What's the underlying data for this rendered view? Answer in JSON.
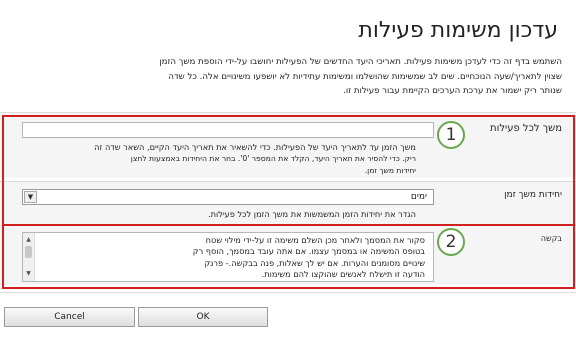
{
  "dialog": {
    "title": "עדכון משימות פעילות",
    "intro": [
      "השתמש בדף זה כדי לעדכן משימות פעילות. תאריכי היעד החדשים של הפעילות יחושבו על-ידי הוספת משך הזמן",
      "שצוין לתאריך/שעה הנוכחיים. שים לב שמשימות שהושלמו ומשימות עתידיות לא יושפעו משינויים אלה. כל שדה",
      "שנותר ריק ישמור את ערכת הערכים הקיימת עבור פעילות זו."
    ]
  },
  "duration_section": {
    "label": "משך לכל פעילות",
    "value": "",
    "description": [
      "משך הזמן עד לתאריך היעד של הפעילות. כדי להשאיר את תאריך היעד הקיים, השאר שדה זה",
      "ריק. כדי להסיר את תאריך היעד, הקלד את המספר '0'. בחר את היחידות באמצעות לחצן",
      "יחידות משך זמן."
    ]
  },
  "units_section": {
    "label": "יחידות משך זמן",
    "selected": "ימים",
    "description": "הגדר את יחידות הזמן המשמשות את משך הזמן לכל פעילות."
  },
  "request_section": {
    "label": "בקשה",
    "text": [
      "סקור את המסמך ולאחר מכן השלם משימה זו על-ידי מילוי שטח",
      "בטופס המשימה או במסמך עצמו. אם אתה עובד במסמך, הוסף רק",
      "שינויים מסומנים והערות. אם יש לך שאלות, פנה בבקשה.- פרנק",
      "הודעה זו תישלח לאנשים שהוקצו להם משימות."
    ]
  },
  "buttons": {
    "ok": "OK",
    "cancel": "Cancel"
  },
  "badges": {
    "one": "1",
    "two": "2"
  },
  "colors": {
    "callout_border": "#d02020",
    "badge_ring": "#6aa84f"
  },
  "icons": {
    "dropdown": "chevron-down-icon",
    "scroll_up": "scroll-up-icon",
    "scroll_down": "scroll-down-icon"
  }
}
